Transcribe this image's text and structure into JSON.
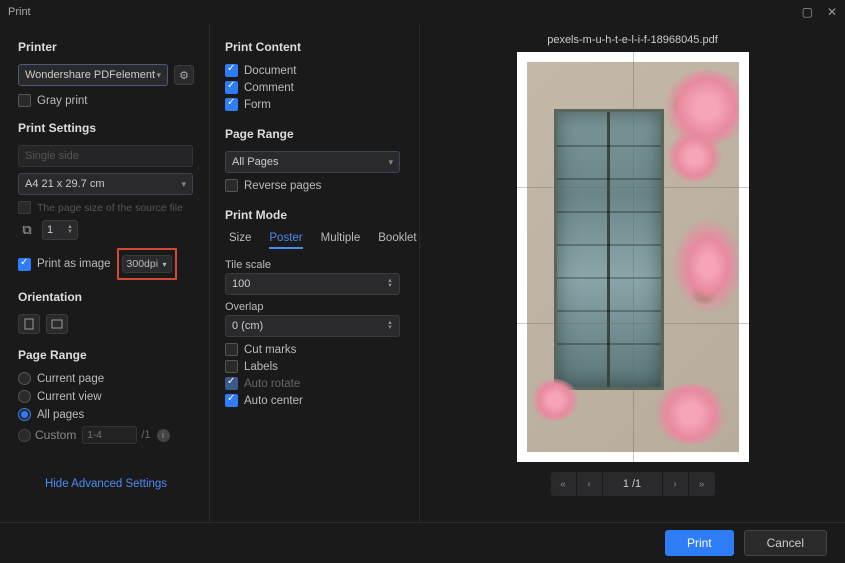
{
  "window": {
    "title": "Print"
  },
  "col1": {
    "printer_section": "Printer",
    "printer_value": "Wondershare PDFelement",
    "gray_print": "Gray print",
    "print_settings": "Print Settings",
    "single_side": "Single side",
    "paper_size": "A4 21 x 29.7 cm",
    "source_file_note": "The page size of the source file",
    "copies_value": "1",
    "print_as_image": "Print as image",
    "dpi_value": "300dpi",
    "orientation": "Orientation",
    "page_range": "Page Range",
    "current_page": "Current page",
    "current_view": "Current view",
    "all_pages": "All pages",
    "custom": "Custom",
    "custom_placeholder": "1-4",
    "custom_total": "/1",
    "hide_advanced": "Hide Advanced Settings"
  },
  "col2": {
    "print_content": "Print Content",
    "document": "Document",
    "comment": "Comment",
    "form": "Form",
    "page_range": "Page Range",
    "all_pages": "All Pages",
    "reverse_pages": "Reverse pages",
    "print_mode": "Print Mode",
    "tabs": {
      "size": "Size",
      "poster": "Poster",
      "multiple": "Multiple",
      "booklet": "Booklet"
    },
    "tile_scale": "Tile scale",
    "tile_scale_value": "100",
    "overlap": "Overlap",
    "overlap_value": "0  (cm)",
    "cut_marks": "Cut marks",
    "labels": "Labels",
    "auto_rotate": "Auto rotate",
    "auto_center": "Auto center"
  },
  "preview": {
    "filename": "pexels-m-u-h-t-e-l-i-f-18968045.pdf",
    "page_current": "1",
    "page_total": "/1"
  },
  "footer": {
    "print": "Print",
    "cancel": "Cancel"
  }
}
